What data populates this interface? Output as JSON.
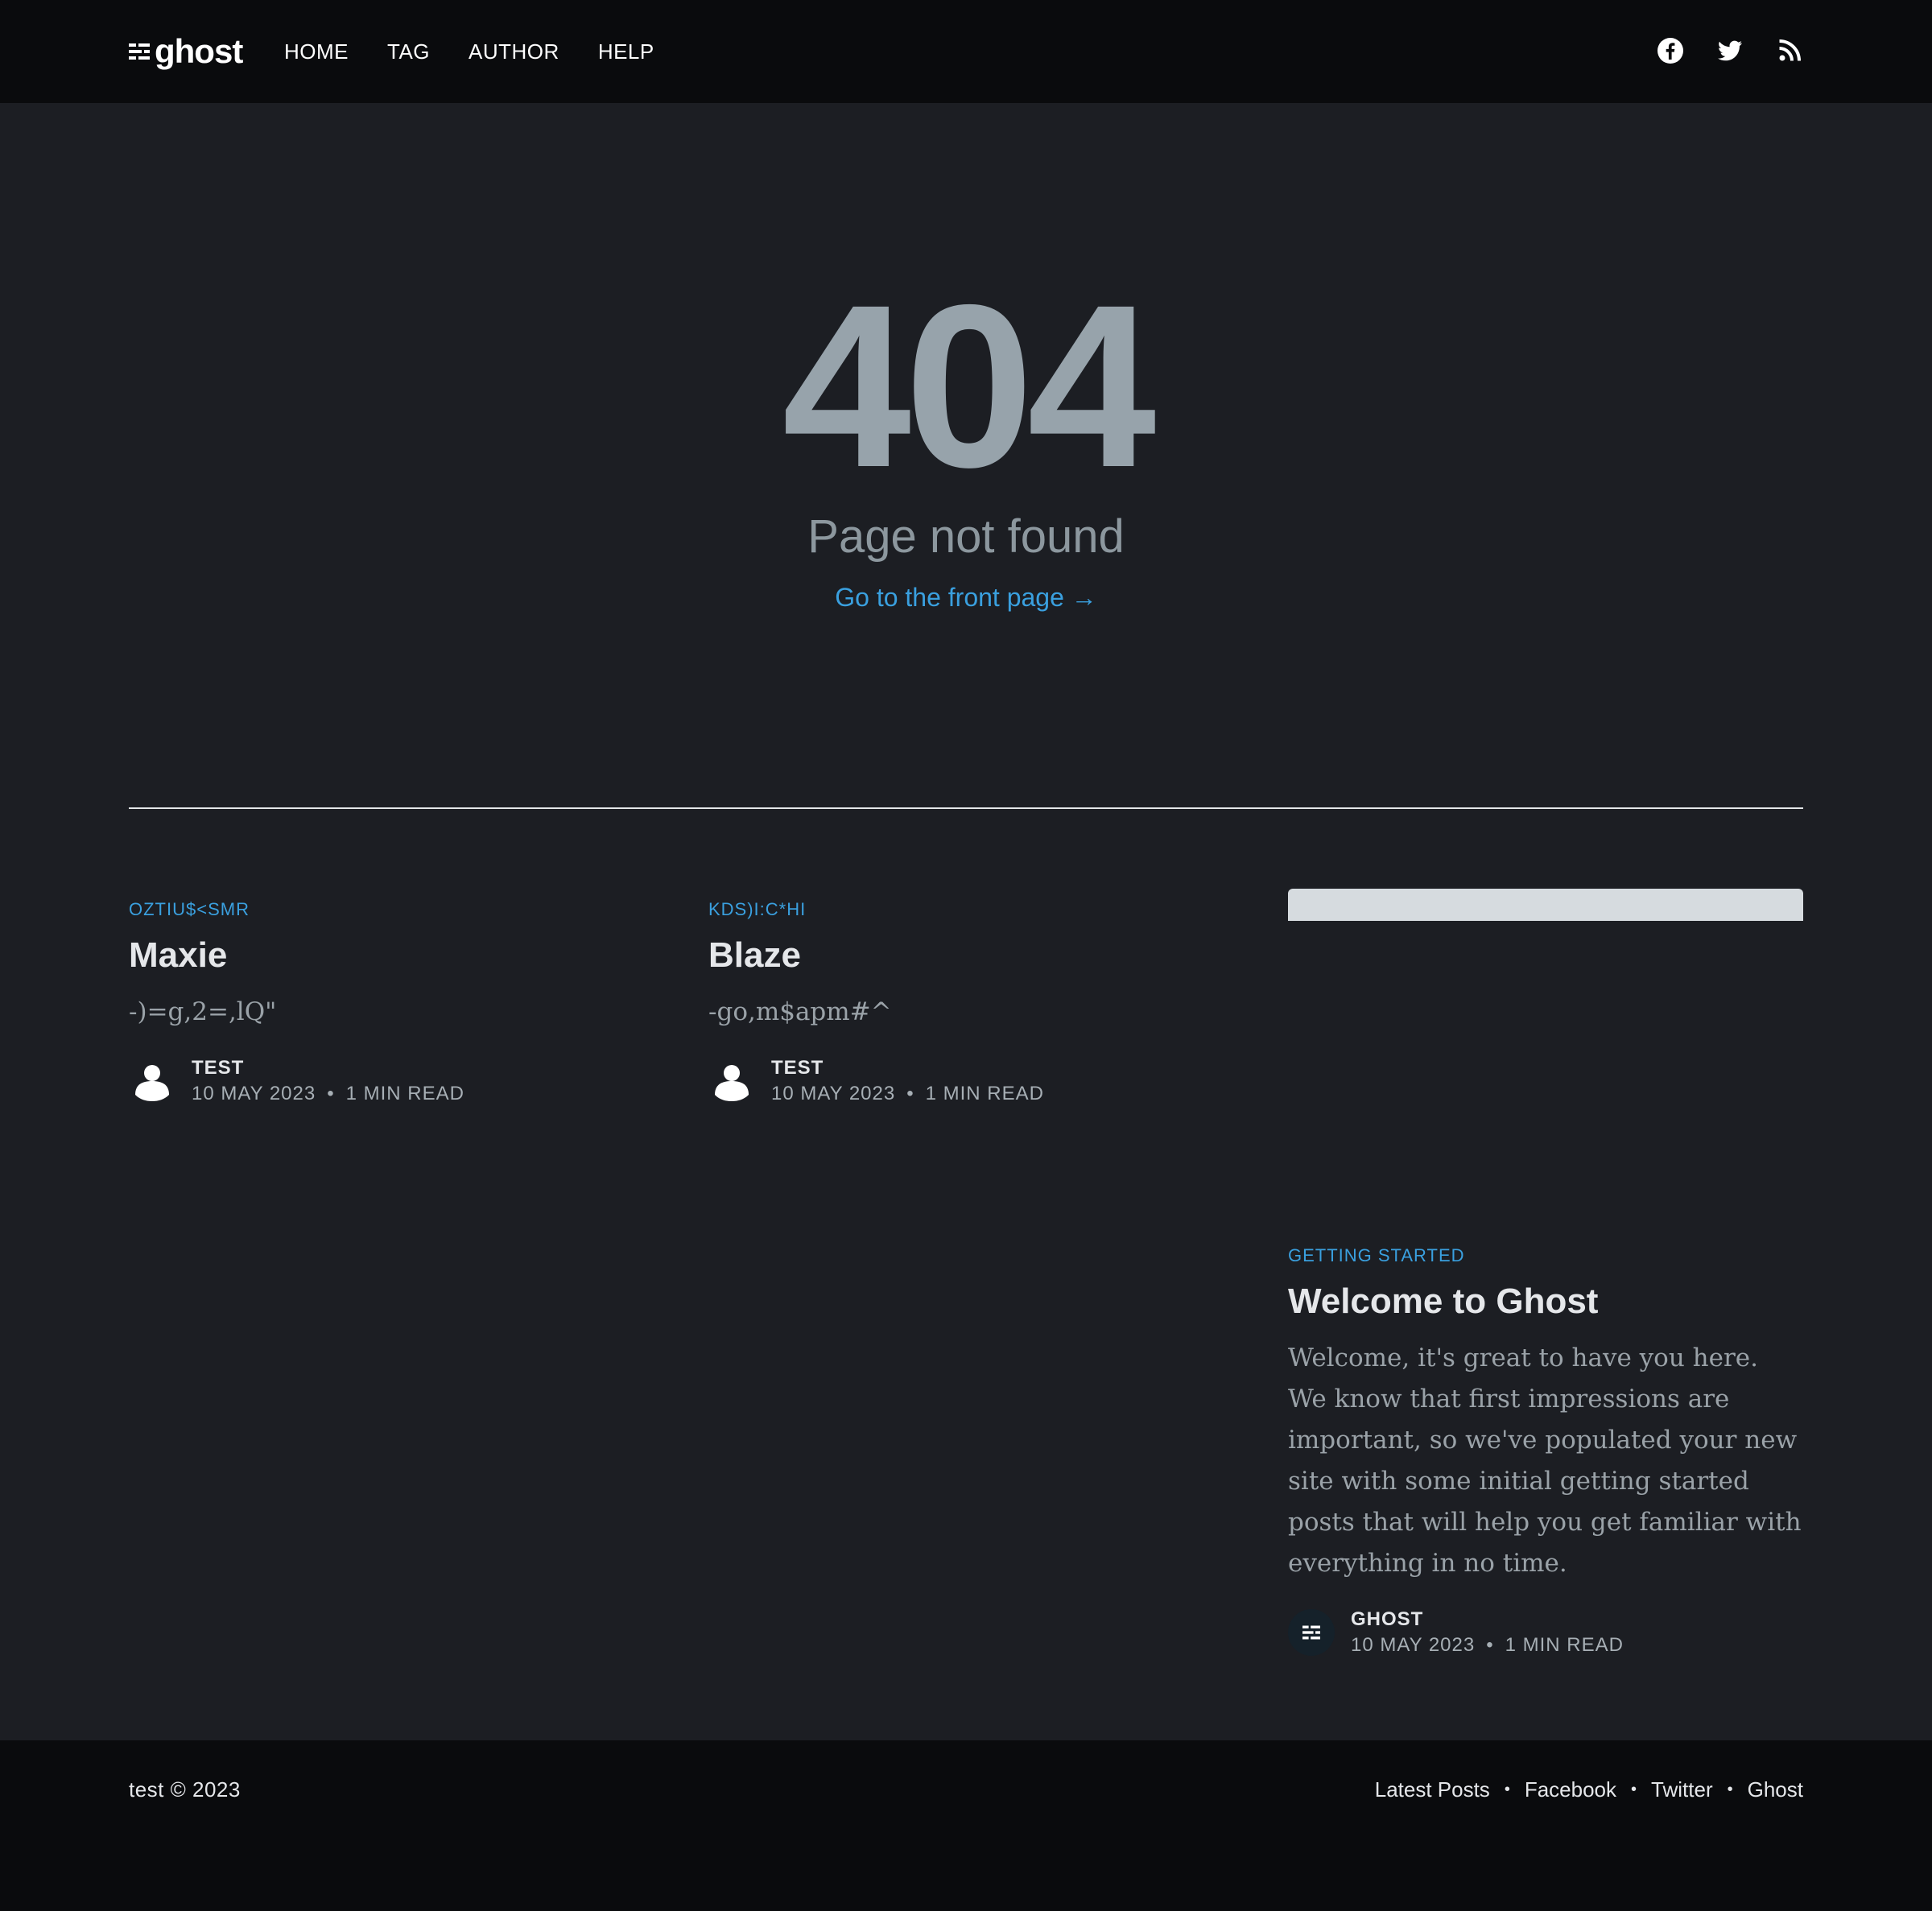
{
  "header": {
    "logo_text": "ghost",
    "nav": [
      "HOME",
      "TAG",
      "AUTHOR",
      "HELP"
    ],
    "social_icons": [
      "facebook-icon",
      "twitter-icon",
      "rss-icon"
    ]
  },
  "error": {
    "code": "404",
    "message": "Page not found",
    "link_label": "Go to the front page →"
  },
  "posts": [
    {
      "tag": "OZTIU$<SMR",
      "title": "Maxie",
      "excerpt": "-)=g,2=,lQ\"",
      "author": "TEST",
      "date": "10 MAY 2023",
      "dot": "•",
      "reading_time": "1 MIN READ"
    },
    {
      "tag": "KDS)I:C*HI",
      "title": "Blaze",
      "excerpt": "-go,m$apm#^",
      "author": "TEST",
      "date": "10 MAY 2023",
      "dot": "•",
      "reading_time": "1 MIN READ"
    },
    {
      "tag": "GETTING STARTED",
      "title": "Welcome to Ghost",
      "excerpt": "Welcome, it's great to have you here. We know that first impressions are important, so we've populated your new site with some initial getting started posts that will help you get familiar with everything in no time.",
      "author": "GHOST",
      "date": "10 MAY 2023",
      "dot": "•",
      "reading_time": "1 MIN READ"
    }
  ],
  "footer": {
    "copyright": "test © 2023",
    "links": [
      "Latest Posts",
      "Facebook",
      "Twitter",
      "Ghost"
    ],
    "separator": "•"
  },
  "colors": {
    "background": "#1c1e23",
    "header_bg": "#0a0b0d",
    "accent": "#3aa0df",
    "error_code": "#97a3ab"
  }
}
